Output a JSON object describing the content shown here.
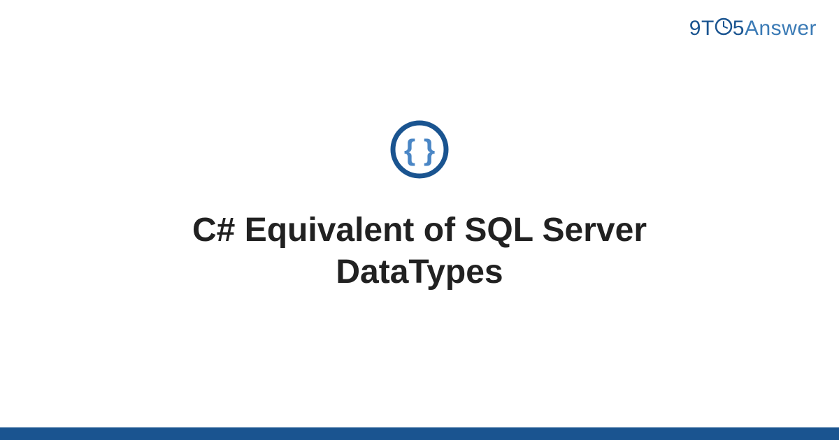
{
  "logo": {
    "nine": "9",
    "t": "T",
    "five": "5",
    "answer": "Answer"
  },
  "title": "C# Equivalent of SQL Server DataTypes",
  "colors": {
    "brand_dark": "#1a5490",
    "brand_light": "#3a7ab5",
    "icon_inner": "#4a86c5",
    "text": "#212121"
  }
}
